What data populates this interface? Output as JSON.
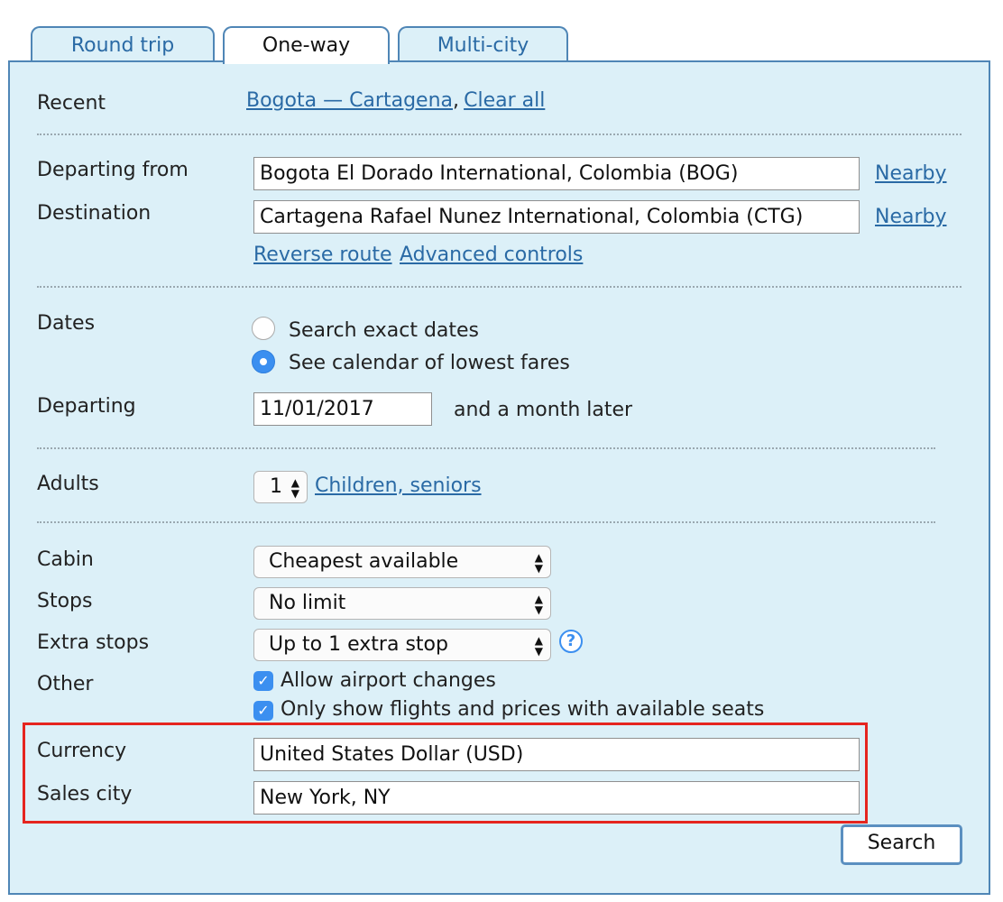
{
  "tabs": {
    "round_trip": "Round trip",
    "one_way": "One-way",
    "multi_city": "Multi-city"
  },
  "recent": {
    "label": "Recent",
    "route_link": "Bogota — Cartagena",
    "comma": ",",
    "clear_link": "Clear all"
  },
  "route": {
    "departing_label": "Departing from",
    "departing_value": "Bogota El Dorado International, Colombia (BOG)",
    "destination_label": "Destination",
    "destination_value": "Cartagena Rafael Nunez International, Colombia (CTG)",
    "nearby": "Nearby",
    "reverse_route": "Reverse route",
    "advanced_controls": "Advanced controls"
  },
  "dates": {
    "label": "Dates",
    "exact": "Search exact dates",
    "calendar": "See calendar of lowest fares",
    "selected_option": "calendar",
    "departing_label": "Departing",
    "departing_value": "11/01/2017",
    "suffix": "and a month later"
  },
  "passengers": {
    "adults_label": "Adults",
    "adults_value": "1",
    "children_link": "Children, seniors"
  },
  "options": {
    "cabin_label": "Cabin",
    "cabin_value": "Cheapest available",
    "stops_label": "Stops",
    "stops_value": "No limit",
    "extra_stops_label": "Extra stops",
    "extra_stops_value": "Up to 1 extra stop",
    "help_icon": "?",
    "other_label": "Other",
    "allow_airport_changes": "Allow airport changes",
    "allow_airport_changes_checked": true,
    "only_available_seats": "Only show flights and prices with available seats",
    "only_available_seats_checked": true
  },
  "sales": {
    "currency_label": "Currency",
    "currency_value": "United States Dollar (USD)",
    "sales_city_label": "Sales city",
    "sales_city_value": "New York, NY"
  },
  "search_button": "Search",
  "colors": {
    "panel": "#dcf0f8",
    "border": "#4f86b6",
    "link": "#2a6aa5",
    "highlight": "#e5251f",
    "control_accent": "#3b8ff0"
  }
}
